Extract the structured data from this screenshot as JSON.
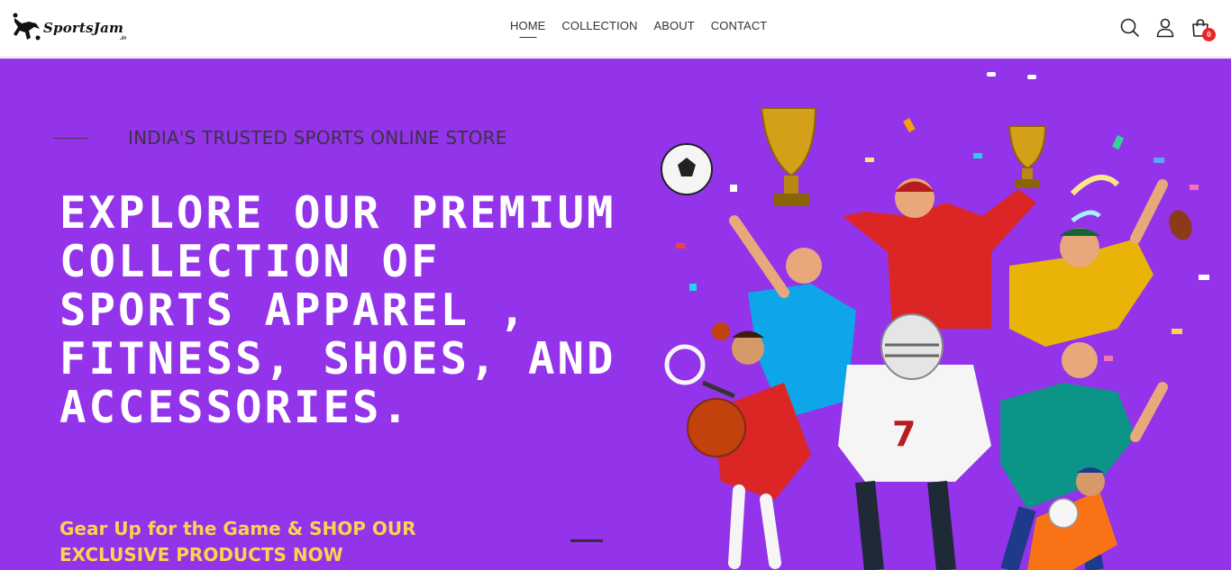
{
  "header": {
    "logo_text": "SportsJam",
    "logo_suffix": ".in",
    "nav": [
      {
        "label": "HOME",
        "active": true
      },
      {
        "label": "COLLECTION",
        "active": false
      },
      {
        "label": "ABOUT",
        "active": false
      },
      {
        "label": "CONTACT",
        "active": false
      }
    ],
    "icons": [
      "search-icon",
      "user-icon",
      "shopping-bag-icon"
    ],
    "cart_count": "0"
  },
  "hero": {
    "tagline": "INDIA'S TRUSTED SPORTS ONLINE STORE",
    "headline": "EXPLORE OUR PREMIUM COLLECTION OF SPORTS APPAREL , FITNESS, SHOES, AND ACCESSORIES.",
    "cta": "Gear Up for the Game & SHOP OUR EXCLUSIVE PRODUCTS NOW",
    "background_color": "#9333ea",
    "cta_color": "#fcd34d"
  },
  "colors": {
    "badge": "#ee2525",
    "header_bg": "#ffffff"
  }
}
